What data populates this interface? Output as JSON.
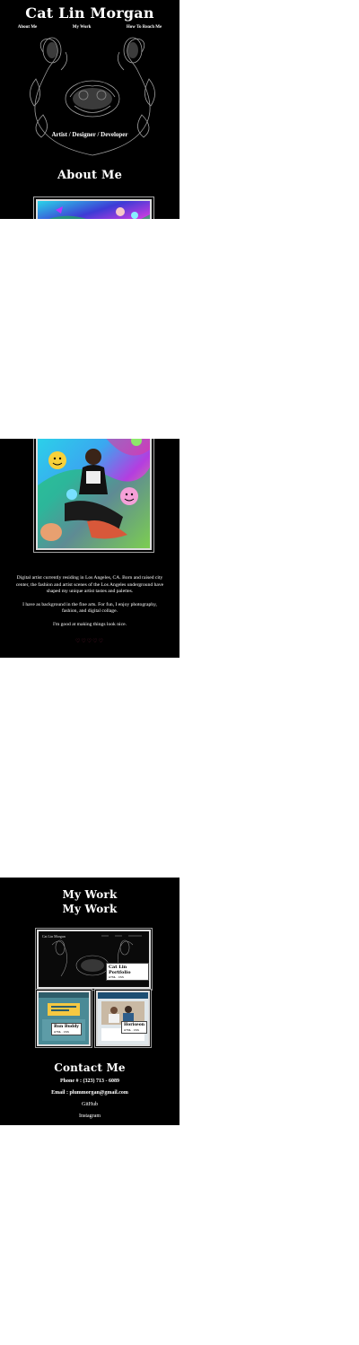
{
  "site": {
    "title": "Cat Lin Morgan",
    "tagline": "Artist / Designer / Developer"
  },
  "nav": {
    "items": [
      {
        "label": "About Me"
      },
      {
        "label": "My Work"
      },
      {
        "label": "How To Reach Me"
      }
    ]
  },
  "about": {
    "heading": "About Me",
    "bio": [
      "Digital artist currently residing in Los Angeles, CA. Born and raised city center, the fashion and artist scenes of the Los Angeles underground have shaped my unique artist tastes and palettes.",
      "I have as background in the fine arts. For fun, I enjoy photography, fashion, and digital collage.",
      "I'm good at making things look nice."
    ],
    "rating_symbols": "♡♡♡♡♡"
  },
  "work": {
    "heading_1": "My Work",
    "heading_2": "My Work",
    "projects": [
      {
        "title": "Cat Lin Portfolio",
        "tech": "HTML · CSS"
      },
      {
        "title": "Run Buddy",
        "tech": "HTML · CSS"
      },
      {
        "title": "Horiseon",
        "tech": "HTML · CSS"
      }
    ],
    "preview_site_title": "Cat Lin Morgan"
  },
  "contact": {
    "heading": "Contact Me",
    "phone": "Phone # : (323) 713 - 6089",
    "email": "Email : plummorgan@gmail.com",
    "github": "GitHub",
    "instagram": "Instagram"
  },
  "colors": {
    "background": "#000000",
    "text": "#ffffff",
    "accent": "#7a1f3b"
  }
}
